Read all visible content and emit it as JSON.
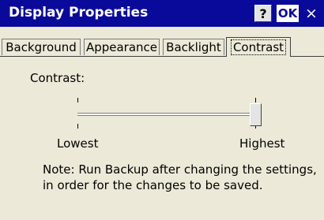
{
  "window": {
    "title": "Display Properties"
  },
  "titlebar": {
    "help_label": "?",
    "ok_label": "OK",
    "close_label": "×"
  },
  "tabs": [
    {
      "label": "Background",
      "active": false
    },
    {
      "label": "Appearance",
      "active": false
    },
    {
      "label": "Backlight",
      "active": false
    },
    {
      "label": "Contrast",
      "active": true
    }
  ],
  "contrast": {
    "label": "Contrast:",
    "min_label": "Lowest",
    "max_label": "Highest",
    "level_fraction": 1.0
  },
  "note": "Note: Run Backup after changing the settings, in order for the changes to be saved.",
  "colors": {
    "titlebar": "#0a0a9a",
    "face": "#ece9d8"
  }
}
